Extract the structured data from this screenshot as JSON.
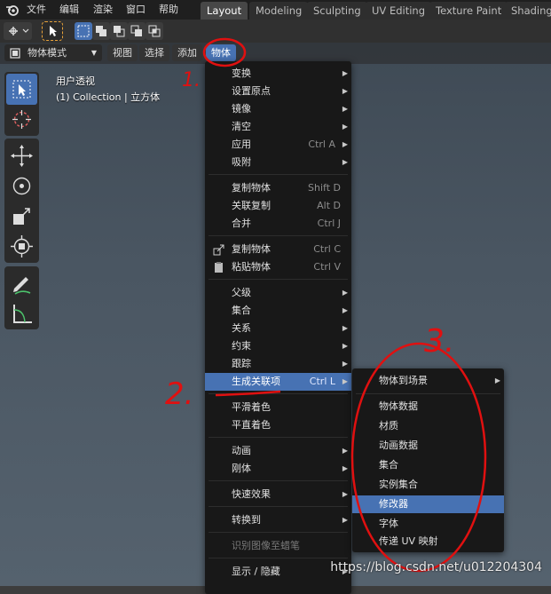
{
  "top_menu": {
    "file": "文件",
    "edit": "编辑",
    "render": "渲染",
    "window": "窗口",
    "help": "帮助"
  },
  "workspace_tabs": [
    "Layout",
    "Modeling",
    "Sculpting",
    "UV Editing",
    "Texture Paint",
    "Shading"
  ],
  "active_workspace": "Layout",
  "header": {
    "mode": "物体模式",
    "view": "视图",
    "select": "选择",
    "add": "添加",
    "object": "物体"
  },
  "viewport": {
    "view_name": "用户透视",
    "collection": "(1) Collection | 立方体"
  },
  "object_menu": {
    "items": [
      {
        "label": "变换",
        "shortcut": "",
        "submenu": true
      },
      {
        "label": "设置原点",
        "shortcut": "",
        "submenu": true
      },
      {
        "label": "镜像",
        "shortcut": "",
        "submenu": true
      },
      {
        "label": "清空",
        "shortcut": "",
        "submenu": true
      },
      {
        "label": "应用",
        "shortcut": "Ctrl A",
        "submenu": true
      },
      {
        "label": "吸附",
        "shortcut": "",
        "submenu": true
      },
      {
        "label": "复制物体",
        "shortcut": "Shift D",
        "submenu": false
      },
      {
        "label": "关联复制",
        "shortcut": "Alt D",
        "submenu": false
      },
      {
        "label": "合并",
        "shortcut": "Ctrl J",
        "submenu": false
      },
      {
        "label": "复制物体",
        "shortcut": "Ctrl C",
        "submenu": false
      },
      {
        "label": "粘贴物体",
        "shortcut": "Ctrl V",
        "submenu": false
      },
      {
        "label": "父级",
        "shortcut": "",
        "submenu": true
      },
      {
        "label": "集合",
        "shortcut": "",
        "submenu": true
      },
      {
        "label": "关系",
        "shortcut": "",
        "submenu": true
      },
      {
        "label": "约束",
        "shortcut": "",
        "submenu": true
      },
      {
        "label": "跟踪",
        "shortcut": "",
        "submenu": true
      },
      {
        "label": "生成关联项",
        "shortcut": "Ctrl L",
        "submenu": true
      },
      {
        "label": "平滑着色",
        "shortcut": "",
        "submenu": false
      },
      {
        "label": "平直着色",
        "shortcut": "",
        "submenu": false
      },
      {
        "label": "动画",
        "shortcut": "",
        "submenu": true
      },
      {
        "label": "刚体",
        "shortcut": "",
        "submenu": true
      },
      {
        "label": "快速效果",
        "shortcut": "",
        "submenu": true
      },
      {
        "label": "转换到",
        "shortcut": "",
        "submenu": true
      },
      {
        "label": "识别图像至蜡笔",
        "shortcut": "",
        "submenu": false
      },
      {
        "label": "显示 / 隐藏",
        "shortcut": "",
        "submenu": true
      }
    ]
  },
  "link_submenu": {
    "items": [
      {
        "label": "物体到场景",
        "submenu": true
      },
      {
        "label": "物体数据",
        "submenu": false
      },
      {
        "label": "材质",
        "submenu": false
      },
      {
        "label": "动画数据",
        "submenu": false
      },
      {
        "label": "集合",
        "submenu": false
      },
      {
        "label": "实例集合",
        "submenu": false
      },
      {
        "label": "修改器",
        "submenu": false
      },
      {
        "label": "字体",
        "submenu": false
      },
      {
        "label": "传递 UV 映射",
        "submenu": false
      }
    ]
  },
  "annotations": [
    "1.",
    "2.",
    "3."
  ],
  "watermark": "https://blog.csdn.net/u012204304",
  "colors": {
    "accent": "#4772b3",
    "annotation_red": "#e01010",
    "menu_bg": "#181818"
  }
}
